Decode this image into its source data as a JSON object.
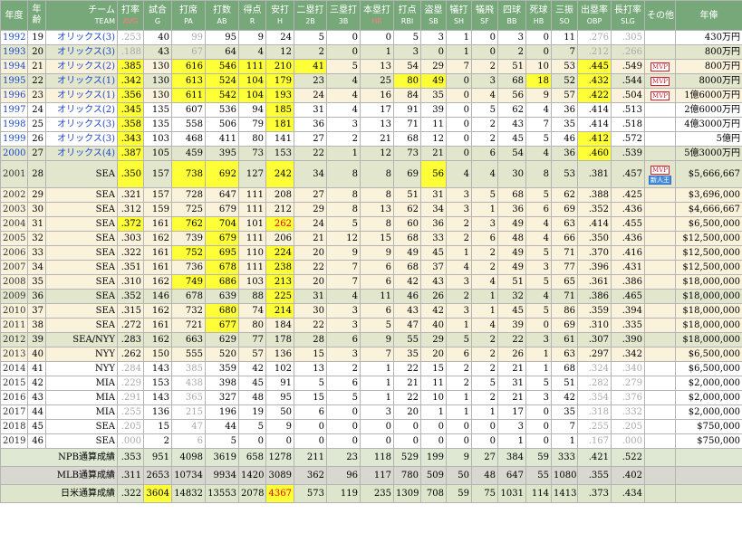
{
  "headers": [
    {
      "j": "年度",
      "e": ""
    },
    {
      "j": "年\n齢",
      "e": ""
    },
    {
      "j": "チーム",
      "e": "TEAM"
    },
    {
      "j": "打率",
      "e": "AVG"
    },
    {
      "j": "試合",
      "e": "G"
    },
    {
      "j": "打席",
      "e": "PA"
    },
    {
      "j": "打数",
      "e": "AB"
    },
    {
      "j": "得点",
      "e": "R"
    },
    {
      "j": "安打",
      "e": "H"
    },
    {
      "j": "二塁打",
      "e": "2B"
    },
    {
      "j": "三塁打",
      "e": "3B"
    },
    {
      "j": "本塁打",
      "e": "HR"
    },
    {
      "j": "打点",
      "e": "RBI"
    },
    {
      "j": "盗塁",
      "e": "SB"
    },
    {
      "j": "犠打",
      "e": "SH"
    },
    {
      "j": "犠飛",
      "e": "SF"
    },
    {
      "j": "四球",
      "e": "BB"
    },
    {
      "j": "死球",
      "e": "HB"
    },
    {
      "j": "三振",
      "e": "SO"
    },
    {
      "j": "出塁率",
      "e": "OBP"
    },
    {
      "j": "長打率",
      "e": "SLG"
    },
    {
      "j": "その他",
      "e": ""
    },
    {
      "j": "年俸",
      "e": ""
    }
  ],
  "rows": [
    {
      "c": [
        "1992",
        "19",
        "オリックス(3)",
        ".253",
        "40",
        "99",
        "95",
        "9",
        "24",
        "5",
        "0",
        "0",
        "5",
        "3",
        "1",
        "0",
        "3",
        "0",
        "11",
        ".276",
        ".305",
        "",
        "430万円"
      ]
    },
    {
      "c": [
        "1993",
        "20",
        "オリックス(3)",
        ".188",
        "43",
        "67",
        "64",
        "4",
        "12",
        "2",
        "0",
        "1",
        "3",
        "0",
        "1",
        "0",
        "2",
        "0",
        "7",
        ".212",
        ".266",
        "",
        "800万円"
      ]
    },
    {
      "c": [
        "1994",
        "21",
        "オリックス(2)",
        ".385",
        "130",
        "616",
        "546",
        "111",
        "210",
        "41",
        "5",
        "13",
        "54",
        "29",
        "7",
        "2",
        "51",
        "10",
        "53",
        ".445",
        ".549",
        "MVP",
        "800万円"
      ]
    },
    {
      "c": [
        "1995",
        "22",
        "オリックス(1)",
        ".342",
        "130",
        "613",
        "524",
        "104",
        "179",
        "23",
        "4",
        "25",
        "80",
        "49",
        "0",
        "3",
        "68",
        "18",
        "52",
        ".432",
        ".544",
        "MVP",
        "8000万円"
      ]
    },
    {
      "c": [
        "1996",
        "23",
        "オリックス(1)",
        ".356",
        "130",
        "611",
        "542",
        "104",
        "193",
        "24",
        "4",
        "16",
        "84",
        "35",
        "0",
        "4",
        "56",
        "9",
        "57",
        ".422",
        ".504",
        "MVP",
        "1億6000万円"
      ]
    },
    {
      "c": [
        "1997",
        "24",
        "オリックス(2)",
        ".345",
        "135",
        "607",
        "536",
        "94",
        "185",
        "31",
        "4",
        "17",
        "91",
        "39",
        "0",
        "5",
        "62",
        "4",
        "36",
        ".414",
        ".513",
        "",
        "2億6000万円"
      ]
    },
    {
      "c": [
        "1998",
        "25",
        "オリックス(3)",
        ".358",
        "135",
        "558",
        "506",
        "79",
        "181",
        "36",
        "3",
        "13",
        "71",
        "11",
        "0",
        "2",
        "43",
        "7",
        "35",
        ".414",
        ".518",
        "",
        "4億3000万円"
      ]
    },
    {
      "c": [
        "1999",
        "26",
        "オリックス(3)",
        ".343",
        "103",
        "468",
        "411",
        "80",
        "141",
        "27",
        "2",
        "21",
        "68",
        "12",
        "0",
        "2",
        "45",
        "5",
        "46",
        ".412",
        ".572",
        "",
        "5億円"
      ]
    },
    {
      "c": [
        "2000",
        "27",
        "オリックス(4)",
        ".387",
        "105",
        "459",
        "395",
        "73",
        "153",
        "22",
        "1",
        "12",
        "73",
        "21",
        "0",
        "6",
        "54",
        "4",
        "36",
        ".460",
        ".539",
        "",
        "5億3000万円"
      ]
    },
    {
      "c": [
        "2001",
        "28",
        "SEA",
        ".350",
        "157",
        "738",
        "692",
        "127",
        "242",
        "34",
        "8",
        "8",
        "69",
        "56",
        "4",
        "4",
        "30",
        "8",
        "53",
        ".381",
        ".457",
        "MVP|新人王",
        "$5,666,667"
      ]
    },
    {
      "c": [
        "2002",
        "29",
        "SEA",
        ".321",
        "157",
        "728",
        "647",
        "111",
        "208",
        "27",
        "8",
        "8",
        "51",
        "31",
        "3",
        "5",
        "68",
        "5",
        "62",
        ".388",
        ".425",
        "",
        "$3,696,000"
      ]
    },
    {
      "c": [
        "2003",
        "30",
        "SEA",
        ".312",
        "159",
        "725",
        "679",
        "111",
        "212",
        "29",
        "8",
        "13",
        "62",
        "34",
        "3",
        "1",
        "36",
        "6",
        "69",
        ".352",
        ".436",
        "",
        "$4,666,667"
      ]
    },
    {
      "c": [
        "2004",
        "31",
        "SEA",
        ".372",
        "161",
        "762",
        "704",
        "101",
        "262",
        "24",
        "5",
        "8",
        "60",
        "36",
        "2",
        "3",
        "49",
        "4",
        "63",
        ".414",
        ".455",
        "",
        "$6,500,000"
      ]
    },
    {
      "c": [
        "2005",
        "32",
        "SEA",
        ".303",
        "162",
        "739",
        "679",
        "111",
        "206",
        "21",
        "12",
        "15",
        "68",
        "33",
        "2",
        "6",
        "48",
        "4",
        "66",
        ".350",
        ".436",
        "",
        "$12,500,000"
      ]
    },
    {
      "c": [
        "2006",
        "33",
        "SEA",
        ".322",
        "161",
        "752",
        "695",
        "110",
        "224",
        "20",
        "9",
        "9",
        "49",
        "45",
        "1",
        "2",
        "49",
        "5",
        "71",
        ".370",
        ".416",
        "",
        "$12,500,000"
      ]
    },
    {
      "c": [
        "2007",
        "34",
        "SEA",
        ".351",
        "161",
        "736",
        "678",
        "111",
        "238",
        "22",
        "7",
        "6",
        "68",
        "37",
        "4",
        "2",
        "49",
        "3",
        "77",
        ".396",
        ".431",
        "",
        "$12,500,000"
      ]
    },
    {
      "c": [
        "2008",
        "35",
        "SEA",
        ".310",
        "162",
        "749",
        "686",
        "103",
        "213",
        "20",
        "7",
        "6",
        "42",
        "43",
        "3",
        "4",
        "51",
        "5",
        "65",
        ".361",
        ".386",
        "",
        "$18,000,000"
      ]
    },
    {
      "c": [
        "2009",
        "36",
        "SEA",
        ".352",
        "146",
        "678",
        "639",
        "88",
        "225",
        "31",
        "4",
        "11",
        "46",
        "26",
        "2",
        "1",
        "32",
        "4",
        "71",
        ".386",
        ".465",
        "",
        "$18,000,000"
      ]
    },
    {
      "c": [
        "2010",
        "37",
        "SEA",
        ".315",
        "162",
        "732",
        "680",
        "74",
        "214",
        "30",
        "3",
        "6",
        "43",
        "42",
        "3",
        "1",
        "45",
        "5",
        "86",
        ".359",
        ".394",
        "",
        "$18,000,000"
      ]
    },
    {
      "c": [
        "2011",
        "38",
        "SEA",
        ".272",
        "161",
        "721",
        "677",
        "80",
        "184",
        "22",
        "3",
        "5",
        "47",
        "40",
        "1",
        "4",
        "39",
        "0",
        "69",
        ".310",
        ".335",
        "",
        "$18,000,000"
      ]
    },
    {
      "c": [
        "2012",
        "39",
        "SEA/NYY",
        ".283",
        "162",
        "663",
        "629",
        "77",
        "178",
        "28",
        "6",
        "9",
        "55",
        "29",
        "5",
        "2",
        "22",
        "3",
        "61",
        ".307",
        ".390",
        "",
        "$18,000,000"
      ]
    },
    {
      "c": [
        "2013",
        "40",
        "NYY",
        ".262",
        "150",
        "555",
        "520",
        "57",
        "136",
        "15",
        "3",
        "7",
        "35",
        "20",
        "6",
        "2",
        "26",
        "1",
        "63",
        ".297",
        ".342",
        "",
        "$6,500,000"
      ]
    },
    {
      "c": [
        "2014",
        "41",
        "NYY",
        ".284",
        "143",
        "385",
        "359",
        "42",
        "102",
        "13",
        "2",
        "1",
        "22",
        "15",
        "2",
        "2",
        "21",
        "1",
        "68",
        ".324",
        ".340",
        "",
        "$6,500,000"
      ]
    },
    {
      "c": [
        "2015",
        "42",
        "MIA",
        ".229",
        "153",
        "438",
        "398",
        "45",
        "91",
        "5",
        "6",
        "1",
        "21",
        "11",
        "2",
        "5",
        "31",
        "5",
        "51",
        ".282",
        ".279",
        "",
        "$2,000,000"
      ]
    },
    {
      "c": [
        "2016",
        "43",
        "MIA",
        ".291",
        "143",
        "365",
        "327",
        "48",
        "95",
        "15",
        "5",
        "1",
        "22",
        "10",
        "1",
        "2",
        "21",
        "3",
        "42",
        ".354",
        ".376",
        "",
        "$2,000,000"
      ]
    },
    {
      "c": [
        "2017",
        "44",
        "MIA",
        ".255",
        "136",
        "215",
        "196",
        "19",
        "50",
        "6",
        "0",
        "3",
        "20",
        "1",
        "1",
        "1",
        "17",
        "0",
        "35",
        ".318",
        ".332",
        "",
        "$2,000,000"
      ]
    },
    {
      "c": [
        "2018",
        "45",
        "SEA",
        ".205",
        "15",
        "47",
        "44",
        "5",
        "9",
        "0",
        "0",
        "0",
        "0",
        "0",
        "0",
        "0",
        "3",
        "0",
        "7",
        ".255",
        ".205",
        "",
        "$750,000"
      ]
    },
    {
      "c": [
        "2019",
        "46",
        "SEA",
        ".000",
        "2",
        "6",
        "5",
        "0",
        "0",
        "0",
        "0",
        "0",
        "0",
        "0",
        "0",
        "0",
        "1",
        "0",
        "1",
        ".167",
        ".000",
        "",
        "$750,000"
      ]
    }
  ],
  "totals": [
    {
      "label": "NPB通算成績",
      "c": [
        ".353",
        "951",
        "4098",
        "3619",
        "658",
        "1278",
        "211",
        "23",
        "118",
        "529",
        "199",
        "9",
        "27",
        "384",
        "59",
        "333",
        ".421",
        ".522"
      ]
    },
    {
      "label": "MLB通算成績",
      "c": [
        ".311",
        "2653",
        "10734",
        "9934",
        "1420",
        "3089",
        "362",
        "96",
        "117",
        "780",
        "509",
        "50",
        "48",
        "647",
        "55",
        "1080",
        ".355",
        ".402"
      ]
    },
    {
      "label": "日米通算成績",
      "c": [
        ".322",
        "3604",
        "14832",
        "13553",
        "2078",
        "4367",
        "573",
        "119",
        "235",
        "1309",
        "708",
        "59",
        "75",
        "1031",
        "114",
        "1413",
        ".373",
        ".434"
      ]
    }
  ]
}
